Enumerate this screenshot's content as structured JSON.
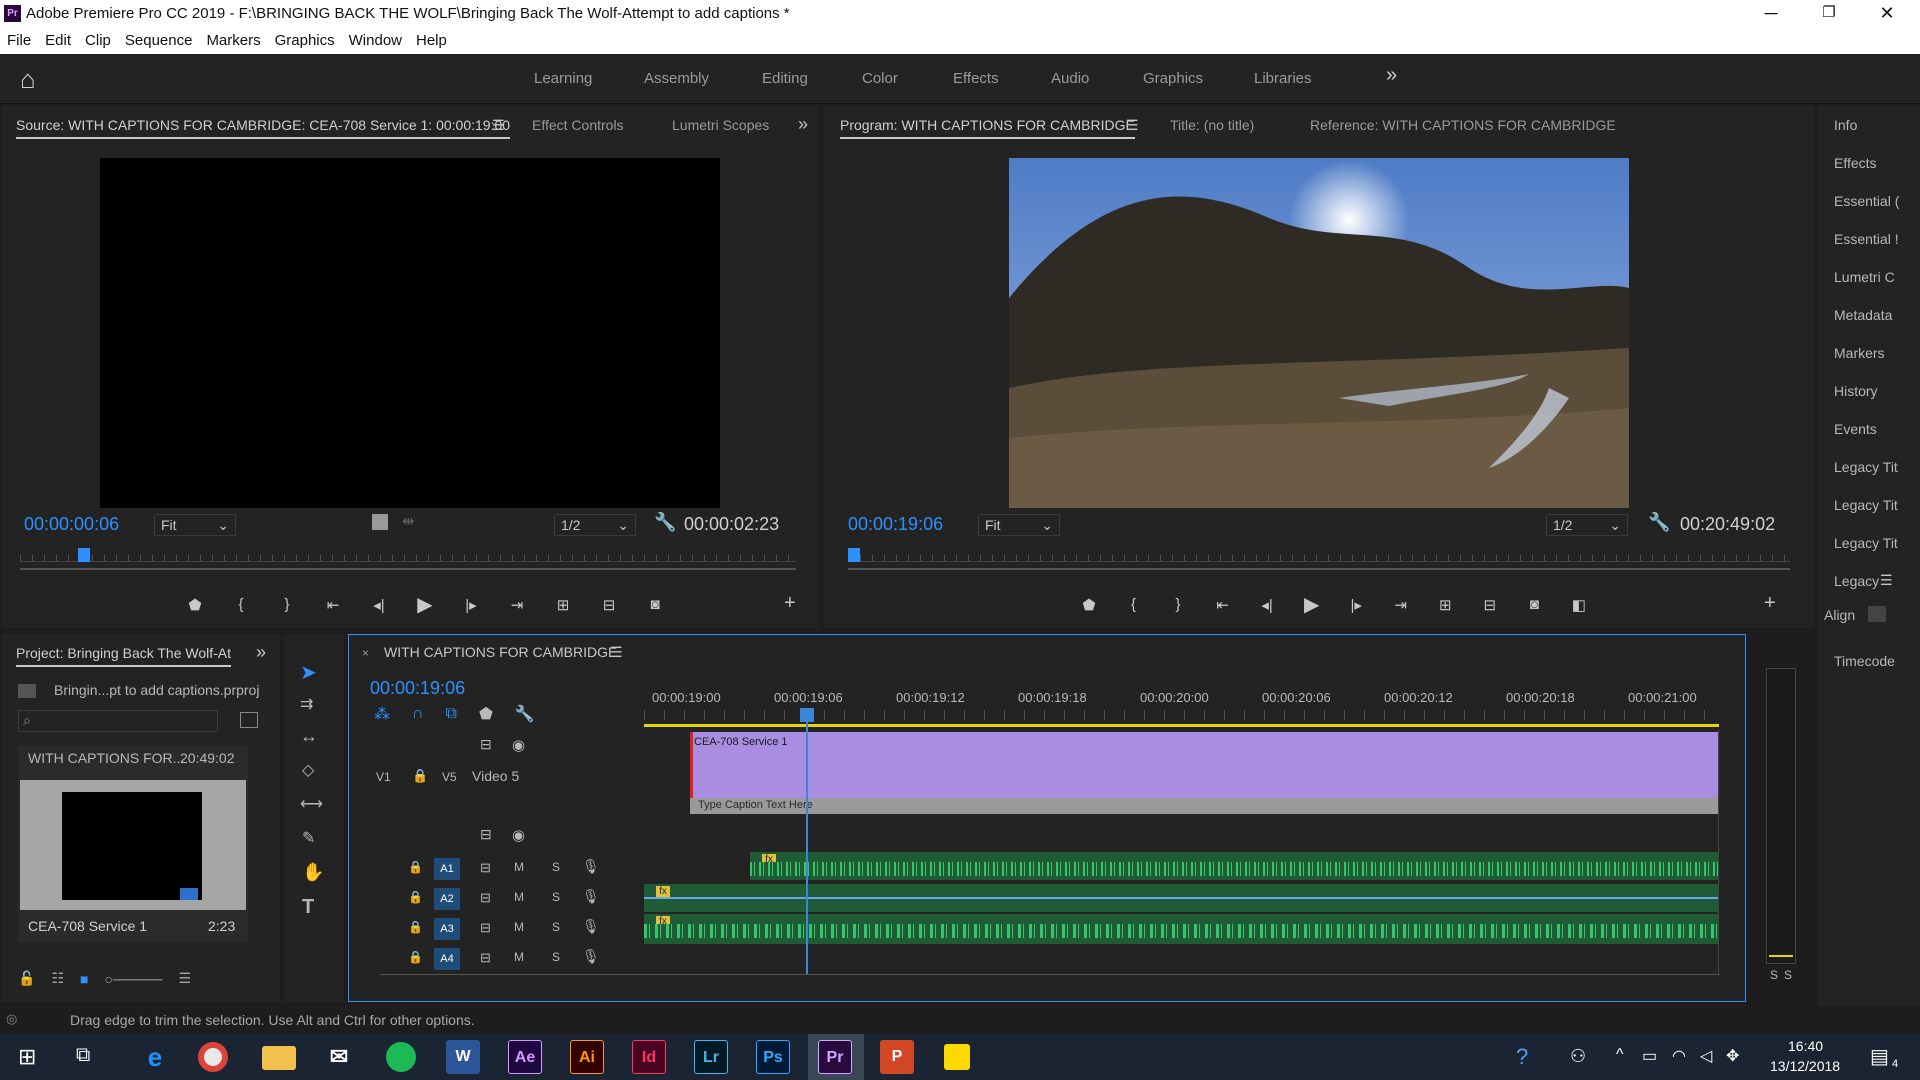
{
  "app": {
    "title": "Adobe Premiere Pro CC 2019 - F:\\BRINGING BACK THE WOLF\\Bringing Back The Wolf-Attempt to add captions *",
    "icon_text": "Pr"
  },
  "window_controls": {
    "minimize": "─",
    "restore": "❐",
    "close": "✕"
  },
  "menu": [
    "File",
    "Edit",
    "Clip",
    "Sequence",
    "Markers",
    "Graphics",
    "Window",
    "Help"
  ],
  "workspaces": {
    "items": [
      "Learning",
      "Assembly",
      "Editing",
      "Color",
      "Effects",
      "Audio",
      "Graphics",
      "Libraries"
    ],
    "more": "»",
    "home_icon": "⌂"
  },
  "source": {
    "tab": "Source: WITH CAPTIONS FOR CAMBRIDGE: CEA-708 Service 1: 00:00:19:00",
    "tabs": [
      "Effect Controls",
      "Lumetri Scopes"
    ],
    "timecode": "00:00:00:06",
    "fit": "Fit",
    "resolution": "1/2",
    "duration": "00:00:02:23"
  },
  "program": {
    "tab": "Program: WITH CAPTIONS FOR CAMBRIDGE",
    "title_tab": "Title: (no title)",
    "reference_tab": "Reference: WITH CAPTIONS FOR CAMBRIDGE",
    "timecode": "00:00:19:06",
    "fit": "Fit",
    "resolution": "1/2",
    "duration": "00:20:49:02"
  },
  "right_panels": [
    "Info",
    "Effects",
    "Essential (",
    "Essential !",
    "Lumetri C",
    "Metadata",
    "Markers",
    "History",
    "Events",
    "Legacy Tit",
    "Legacy Tit",
    "Legacy Tit",
    "Legacy",
    "Align",
    "Timecode"
  ],
  "project": {
    "tab": "Project: Bringing Back The Wolf-At",
    "file": "Bringin...pt to add captions.prproj",
    "item_name": "WITH CAPTIONS FOR...",
    "item_duration": "20:49:02",
    "clip_name": "CEA-708 Service 1",
    "clip_duration": "2:23"
  },
  "timeline": {
    "tab": "WITH CAPTIONS FOR CAMBRIDGE",
    "timecode": "00:00:19:06",
    "ruler": [
      "00:00:19:00",
      "00:00:19:06",
      "00:00:19:12",
      "00:00:19:18",
      "00:00:20:00",
      "00:00:20:06",
      "00:00:20:12",
      "00:00:20:18",
      "00:00:21:00"
    ],
    "caption_clip": "CEA-708 Service 1",
    "caption_text": "Type Caption Text Here",
    "v1": "V1",
    "v5": "V5",
    "video5": "Video 5",
    "audio_tracks": [
      "A1",
      "A2",
      "A3",
      "A4"
    ],
    "m": "M",
    "s": "S",
    "fx": "fx"
  },
  "meter": {
    "s_left": "S",
    "s_right": "S"
  },
  "status": "Drag edge to trim the selection. Use Alt and Ctrl for other options.",
  "taskbar": {
    "time": "16:40",
    "date": "13/12/2018",
    "notif_count": "4",
    "apps": [
      "Ae",
      "Ai",
      "Id",
      "Lr",
      "Ps",
      "Pr"
    ]
  },
  "colors": {
    "accent": "#2e90ff",
    "caption_clip": "#a88de0",
    "audio": "#2aa05a",
    "playhead": "#3a87d6",
    "workarea": "#e6d800"
  }
}
